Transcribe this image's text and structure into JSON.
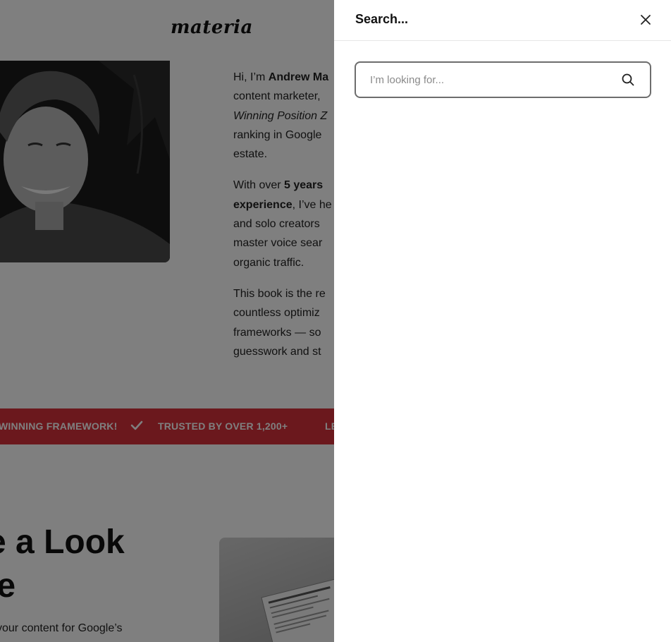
{
  "site": {
    "logo_text": "materia"
  },
  "bio": {
    "p1_line1_pre": "Hi, I’m ",
    "p1_line1_bold": "Andrew Ma",
    "p1_line2": "content marketer,",
    "p1_line3": "Winning Position Z",
    "p1_line4": "ranking in Google",
    "p1_line5": "estate.",
    "p2_line1_pre": "With over ",
    "p2_line1_bold": "5 years",
    "p2_line2_bold": "experience",
    "p2_line2_rest": ", I’ve he",
    "p2_line3": "and solo creators",
    "p2_line4": "master voice sear",
    "p2_line5": "organic traffic.",
    "p3_line1": "This book is the re",
    "p3_line2": "countless optimiz",
    "p3_line3": "frameworks — so",
    "p3_line4": "guesswork and st"
  },
  "ticker": {
    "item1": "WINNING FRAMEWORK!",
    "item2": "TRUSTED BY OVER 1,200+",
    "item3": "LE",
    "color": "#d6303a"
  },
  "section": {
    "heading_line1": "e a Look",
    "heading_line2": "le",
    "subtext": "your content for Google’s"
  },
  "drawer": {
    "title": "Search...",
    "search_placeholder": "I’m looking for...",
    "search_value": "",
    "close_icon": "close-icon",
    "search_icon": "search-icon"
  }
}
